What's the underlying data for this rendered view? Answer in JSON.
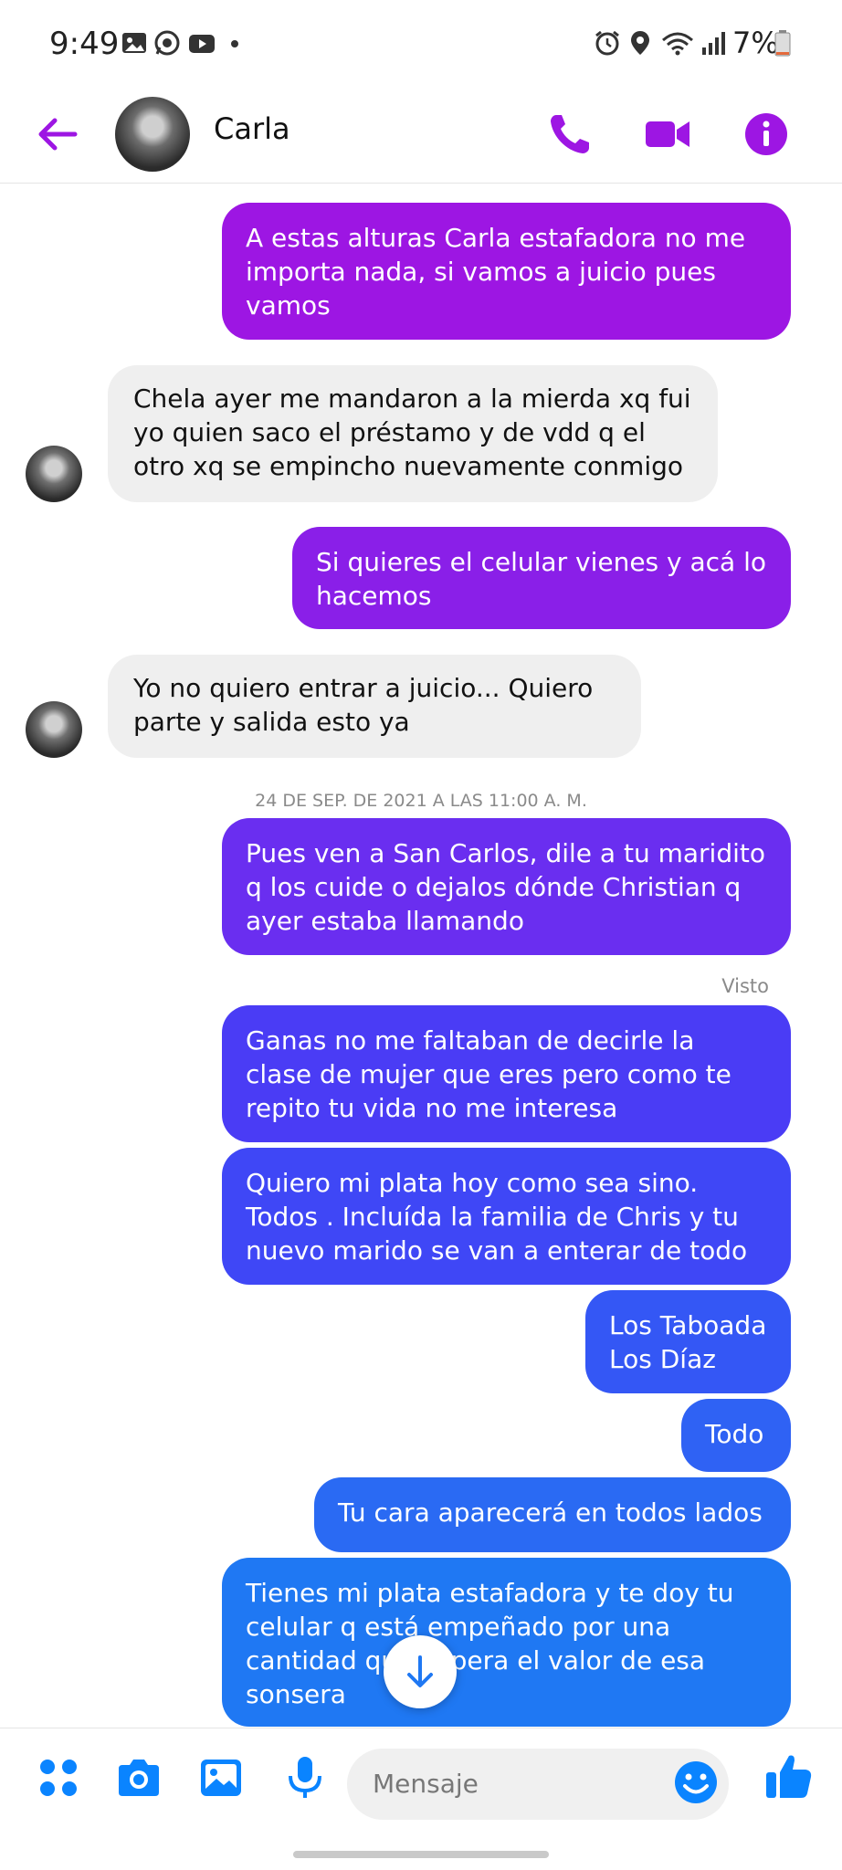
{
  "status_bar": {
    "time": "9:49",
    "battery": "7%"
  },
  "header": {
    "contact_name": "Carla"
  },
  "messages": [
    {
      "dir": "out",
      "text": "A estas alturas Carla estafadora no me importa nada, si vamos a juicio pues vamos",
      "color": "#9d16e3"
    },
    {
      "dir": "in",
      "text": "Chela ayer me mandaron a la mierda xq fui yo quien saco el préstamo y de vdd q el otro xq se empincho nuevamente conmigo"
    },
    {
      "dir": "out",
      "text": "Si quieres el celular vienes y acá lo hacemos",
      "color": "#8a1fe8"
    },
    {
      "dir": "in",
      "text": "Yo no quiero entrar a juicio... Quiero parte y salida esto ya"
    },
    {
      "dir": "out",
      "text": "Pues ven a San Carlos, dile a tu maridito q los cuide o dejalos dónde Christian q ayer estaba llamando",
      "color": "#6a2ef0"
    },
    {
      "dir": "out",
      "text": "Ganas no me faltaban de decirle la clase de mujer que eres pero como te repito tu vida no me interesa",
      "color": "#4a3cf5"
    },
    {
      "dir": "out",
      "text": "Quiero mi plata hoy como sea sino. Todos . Incluída la familia de Chris y tu nuevo marido se van a enterar de todo",
      "color": "#3f47f6"
    },
    {
      "dir": "out",
      "text": "Los Taboada\nLos Díaz",
      "color": "#3457f5"
    },
    {
      "dir": "out",
      "text": "Todo",
      "color": "#2f62f4"
    },
    {
      "dir": "out",
      "text": "Tu cara aparecerá en todos lados",
      "color": "#2a6af3"
    },
    {
      "dir": "out",
      "text": "Tienes mi plata estafadora y te doy tu celular q está empeñado por una cantidad que supera el valor de esa sonsera",
      "color": "#1f78f3"
    }
  ],
  "timestamp": "24 DE SEP. DE 2021 A LAS 11:00 A. M.",
  "seen_label": "Visto",
  "composer": {
    "placeholder": "Mensaje"
  },
  "icons": {
    "header": [
      "back-arrow-icon",
      "phone-icon",
      "video-camera-icon",
      "info-icon"
    ],
    "composer": [
      "apps-icon",
      "camera-icon",
      "gallery-icon",
      "microphone-icon",
      "emoji-icon",
      "thumbs-up-icon"
    ],
    "status": [
      "gallery-notification-icon",
      "whatsapp-icon",
      "youtube-icon",
      "alarm-icon",
      "location-icon",
      "wifi-icon",
      "signal-icon",
      "battery-icon"
    ]
  },
  "colors": {
    "accent_purple": "#9d16e3",
    "accent_blue": "#0a84ff",
    "incoming_bubble": "#efefef"
  }
}
